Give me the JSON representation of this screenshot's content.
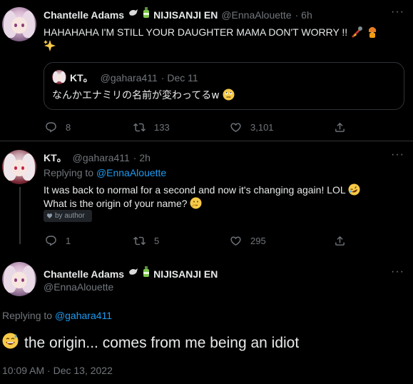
{
  "tweet1": {
    "name": "Chantelle Adams",
    "affiliation": "NIJISANJI EN",
    "handle": "@EnnaAlouette",
    "time": "· 6h",
    "text": "HAHAHAHA I'M STILL YOUR DAUGHTER MAMA DON'T WORRY !!",
    "quote": {
      "name": "KT。",
      "handle": "@gahara411",
      "date": "· Dec 11",
      "text": "なんかエナミリの名前が変わってるw"
    },
    "replies": "8",
    "retweets": "133",
    "likes": "3,101"
  },
  "tweet2": {
    "name": "KT。",
    "handle": "@gahara411",
    "time": "· 2h",
    "replying_prefix": "Replying to",
    "replying_to": "@EnnaAlouette",
    "text_line1": "It was back to normal for a second and now it's changing again! LOL",
    "text_line2": "What is the origin of your name?",
    "by_author": "by author",
    "replies": "1",
    "retweets": "5",
    "likes": "295"
  },
  "tweet3": {
    "name": "Chantelle Adams",
    "affiliation": "NIJISANJI EN",
    "handle": "@EnnaAlouette",
    "replying_prefix": "Replying to",
    "replying_to": "@gahara411",
    "text": "the origin... comes from me being an idiot",
    "timestamp": "10:09 AM · Dec 13, 2022"
  },
  "icons": {
    "more": "more-icon",
    "reply": "reply-icon",
    "retweet": "retweet-icon",
    "like": "like-icon",
    "share": "share-icon"
  },
  "colors": {
    "background": "#000000",
    "text": "#e7e9ea",
    "muted": "#71767b",
    "link": "#1d9bf0"
  }
}
